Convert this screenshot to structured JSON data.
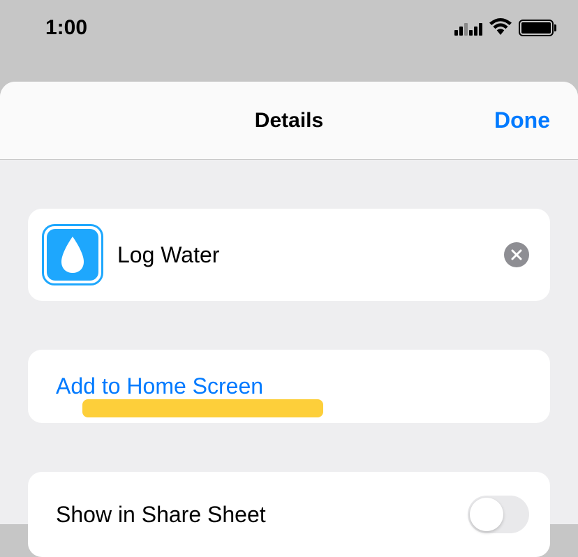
{
  "statusBar": {
    "time": "1:00"
  },
  "nav": {
    "title": "Details",
    "done": "Done"
  },
  "shortcut": {
    "name": "Log Water"
  },
  "actions": {
    "addToHome": "Add to Home Screen",
    "shareSheet": "Show in Share Sheet"
  }
}
